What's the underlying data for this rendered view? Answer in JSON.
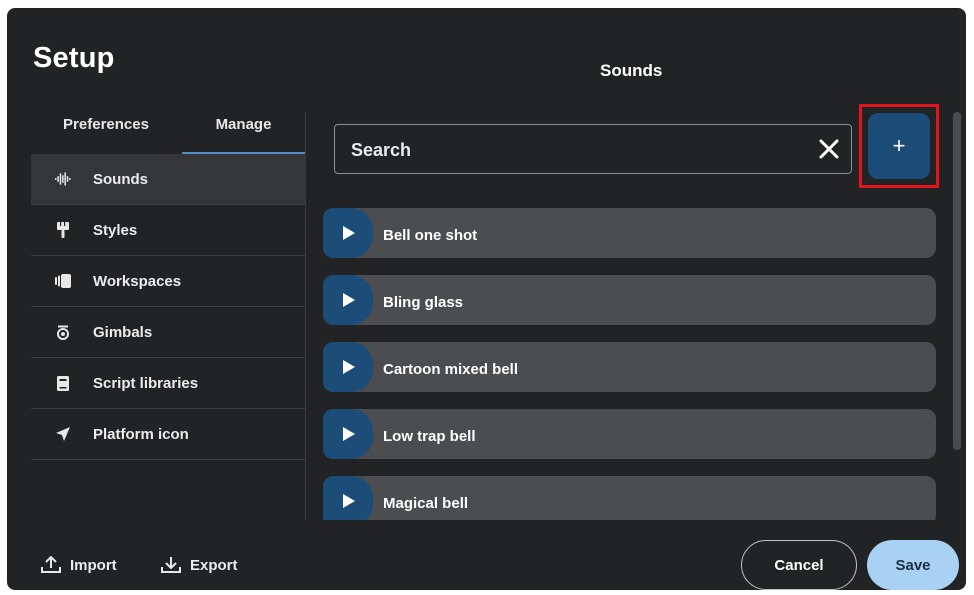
{
  "dialog": {
    "title": "Setup",
    "panel_title": "Sounds"
  },
  "tabs": [
    {
      "label": "Preferences",
      "active": false
    },
    {
      "label": "Manage",
      "active": true
    }
  ],
  "sidebar": {
    "items": [
      {
        "label": "Sounds",
        "icon": "waveform-icon",
        "active": true
      },
      {
        "label": "Styles",
        "icon": "brush-icon",
        "active": false
      },
      {
        "label": "Workspaces",
        "icon": "workspaces-icon",
        "active": false
      },
      {
        "label": "Gimbals",
        "icon": "gimbal-icon",
        "active": false
      },
      {
        "label": "Script libraries",
        "icon": "book-icon",
        "active": false
      },
      {
        "label": "Platform icon",
        "icon": "navigation-arrow-icon",
        "active": false
      }
    ]
  },
  "search": {
    "placeholder": "Search",
    "value": ""
  },
  "add_button": {
    "label": "+"
  },
  "sounds": [
    {
      "label": "Bell one shot"
    },
    {
      "label": "Bling glass"
    },
    {
      "label": "Cartoon mixed bell"
    },
    {
      "label": "Low trap bell"
    },
    {
      "label": "Magical bell"
    }
  ],
  "footer": {
    "import_label": "Import",
    "export_label": "Export",
    "cancel_label": "Cancel",
    "save_label": "Save"
  },
  "colors": {
    "background": "#222325",
    "accent_blue": "#1b4d78",
    "save_blue": "#a8d1f3",
    "row_gray": "#4b4d51",
    "highlight_red": "#e3141e"
  }
}
